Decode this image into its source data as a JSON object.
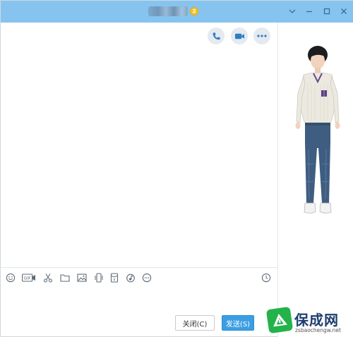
{
  "titlebar": {
    "title_badge": "2",
    "buttons": [
      "chevron-down",
      "minimize",
      "maximize",
      "close"
    ]
  },
  "chat_header_actions": [
    "voice-call",
    "video-call",
    "more"
  ],
  "input_toolbar": {
    "icons": [
      "emoji",
      "gif",
      "screenshot-scissors",
      "folder",
      "image",
      "phone-shake",
      "red-packet",
      "music",
      "more",
      "history"
    ],
    "gif_label": "GIF"
  },
  "buttons": {
    "close_label": "关闭(C)",
    "send_label": "发送(S)"
  },
  "watermark": {
    "brand": "保成网",
    "url": "zsbaochengw.net"
  },
  "colors": {
    "titlebar": "#86c4ef",
    "send_button": "#3b9ee3",
    "icon": "#5a8ab8"
  }
}
